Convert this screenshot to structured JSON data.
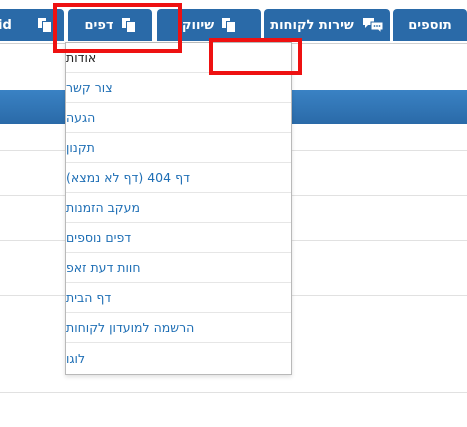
{
  "nav": {
    "tabs": [
      {
        "label": "תוספים"
      },
      {
        "label": "שירות לקוחות"
      },
      {
        "label": "שיווק"
      },
      {
        "label": "דפים"
      },
      {
        "label": "id"
      }
    ]
  },
  "dropdown": {
    "items": [
      {
        "label": "אודות"
      },
      {
        "label": "צור קשר"
      },
      {
        "label": "הגעה"
      },
      {
        "label": "תקנון"
      },
      {
        "label": "דף 404 (דף לא נמצא)"
      },
      {
        "label": "מעקב הזמנות"
      },
      {
        "label": "דפים נוספים"
      },
      {
        "label": "חוות דעת זאפ"
      },
      {
        "label": "דף הבית"
      },
      {
        "label": "הרשמה למועדון לקוחות"
      },
      {
        "label": "לוגו"
      }
    ]
  },
  "colors": {
    "nav_bg": "#2a6aa8",
    "link": "#1f6fb5",
    "highlight": "#ee1111"
  }
}
